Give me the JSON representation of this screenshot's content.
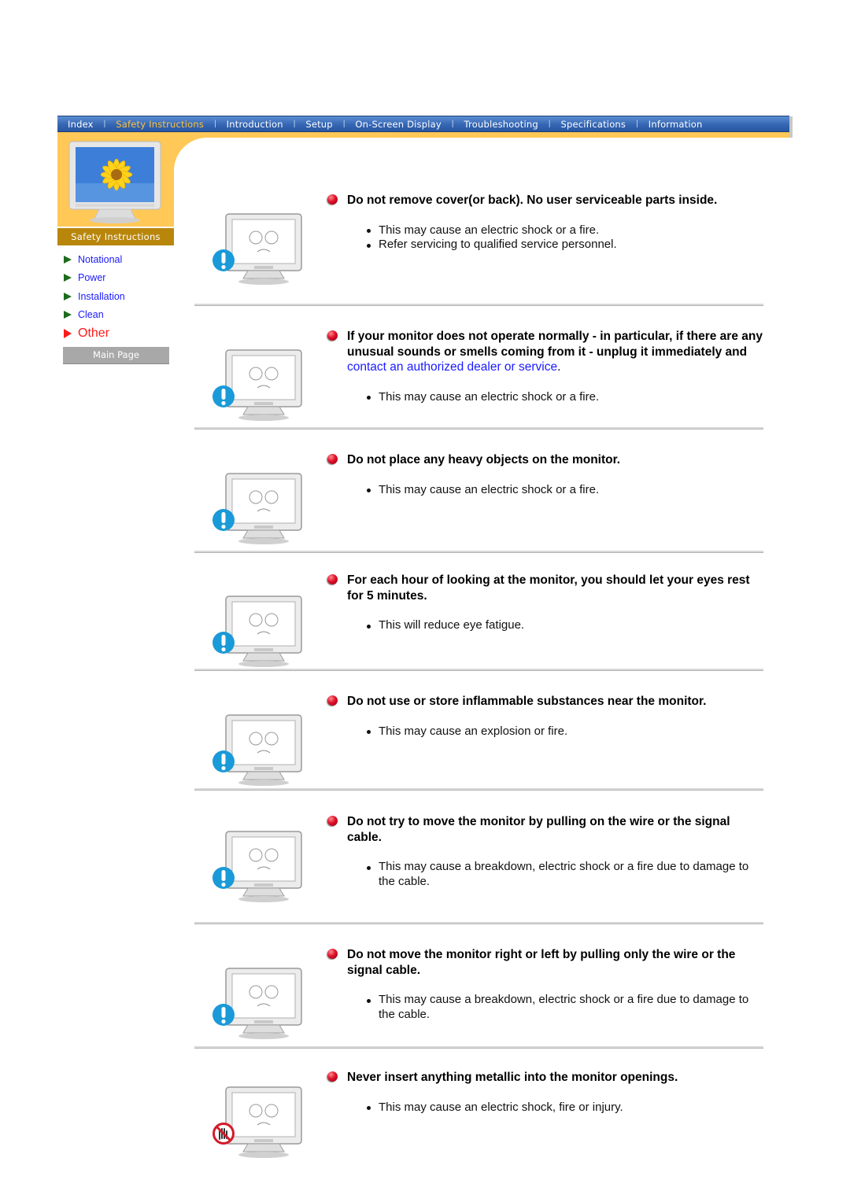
{
  "nav": {
    "items": [
      {
        "label": "Index",
        "active": false
      },
      {
        "label": "Safety Instructions",
        "active": true
      },
      {
        "label": "Introduction",
        "active": false
      },
      {
        "label": "Setup",
        "active": false
      },
      {
        "label": "On-Screen Display",
        "active": false
      },
      {
        "label": "Troubleshooting",
        "active": false
      },
      {
        "label": "Specifications",
        "active": false
      },
      {
        "label": "Information",
        "active": false
      }
    ],
    "separator": "|"
  },
  "sidebar": {
    "title": "Safety Instructions",
    "items": [
      {
        "label": "Notational",
        "current": false
      },
      {
        "label": "Power",
        "current": false
      },
      {
        "label": "Installation",
        "current": false
      },
      {
        "label": "Clean",
        "current": false
      },
      {
        "label": "Other",
        "current": true
      }
    ],
    "main_page_label": "Main Page"
  },
  "colors": {
    "nav_bg": "#3566b4",
    "nav_active": "#ffc23c",
    "orange": "#ffc857",
    "sidebar_title_bg": "#b8860b",
    "link": "#1a1aff",
    "current": "#ff1a1a",
    "warning_icon": "#1a9ad8"
  },
  "sections": [
    {
      "heading": "Do not remove cover(or back). No user serviceable parts inside.",
      "link": "",
      "heading_tail": "",
      "bullets": [
        "This may cause an electric shock or a fire.",
        "Refer servicing to qualified service personnel."
      ],
      "icon": "warning-icon"
    },
    {
      "heading": "If your monitor does not operate normally - in particular, if there are any unusual sounds or smells coming from it - unplug it immediately and ",
      "link": "contact an authorized dealer or service",
      "heading_tail": ".",
      "bullets": [
        "This may cause an electric shock or a fire."
      ],
      "icon": "warning-icon"
    },
    {
      "heading": "Do not place any heavy objects on the monitor.",
      "link": "",
      "heading_tail": "",
      "bullets": [
        "This may cause an electric shock or a fire."
      ],
      "icon": "warning-icon"
    },
    {
      "heading": "For each hour of looking at the monitor, you should let your eyes rest for 5 minutes.",
      "link": "",
      "heading_tail": "",
      "bullets": [
        "This will reduce eye fatigue."
      ],
      "icon": "warning-icon"
    },
    {
      "heading": "Do not use or store inflammable substances near the monitor.",
      "link": "",
      "heading_tail": "",
      "bullets": [
        "This may cause an explosion or fire."
      ],
      "icon": "warning-icon"
    },
    {
      "heading": "Do not try to move the monitor by pulling on the wire or the signal cable.",
      "link": "",
      "heading_tail": "",
      "bullets": [
        "This may cause a breakdown, electric shock or a fire due to damage to the cable."
      ],
      "icon": "warning-icon"
    },
    {
      "heading": "Do not move the monitor right or left by pulling only the wire or the signal cable.",
      "link": "",
      "heading_tail": "",
      "bullets": [
        "This may cause a breakdown, electric shock or a fire due to damage to the cable."
      ],
      "icon": "warning-icon"
    },
    {
      "heading": "Never insert anything metallic into the monitor openings.",
      "link": "",
      "heading_tail": "",
      "bullets": [
        "This may cause an electric shock, fire or injury."
      ],
      "icon": "prohibited-icon"
    }
  ]
}
